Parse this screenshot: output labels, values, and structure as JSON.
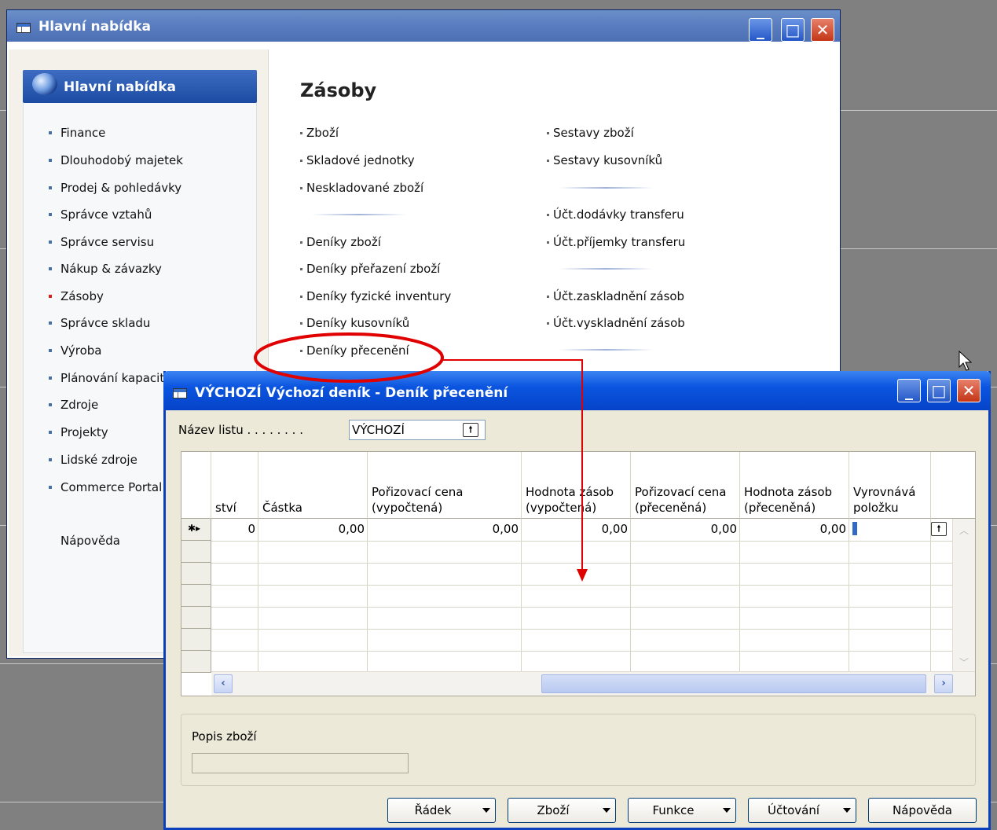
{
  "main_window": {
    "title": "Hlavní nabídka",
    "panel_header": "Hlavní nabídka",
    "nav_items": [
      {
        "label": "Finance"
      },
      {
        "label": "Dlouhodobý majetek"
      },
      {
        "label": "Prodej & pohledávky"
      },
      {
        "label": "Správce vztahů"
      },
      {
        "label": "Správce servisu"
      },
      {
        "label": "Nákup & závazky"
      },
      {
        "label": "Zásoby",
        "active": true
      },
      {
        "label": "Správce skladu"
      },
      {
        "label": "Výroba"
      },
      {
        "label": "Plánování kapacit"
      },
      {
        "label": "Zdroje"
      },
      {
        "label": "Projekty"
      },
      {
        "label": "Lidské zdroje"
      },
      {
        "label": "Commerce Portal"
      }
    ],
    "help_label": "Nápověda",
    "section_title": "Zásoby",
    "links_left": [
      "Zboží",
      "Skladové jednotky",
      "Neskladované zboží",
      "Deníky zboží",
      "Deníky přeřazení zboží",
      "Deníky fyzické inventury",
      "Deníky kusovníků",
      "Deníky přecenění"
    ],
    "links_right": [
      "Sestavy zboží",
      "Sestavy kusovníků",
      "Účt.dodávky transferu",
      "Účt.příjemky transferu",
      "Účt.zaskladnění zásob",
      "Účt.vyskladnění zásob"
    ]
  },
  "journal_window": {
    "title": "VÝCHOZÍ Výchozí deník - Deník přecenění",
    "batch_label": "Název listu . . . . . . . .",
    "batch_value": "VÝCHOZÍ",
    "columns": [
      "ství",
      "Částka",
      "Pořizovací cena\n(vypočtená)",
      "Hodnota zásob\n(vypočtená)",
      "Pořizovací cena\n(přeceněná)",
      "Hodnota zásob\n(přeceněná)",
      "Vyrovnává\npoložku"
    ],
    "row_values": [
      "0",
      "0,00",
      "0,00",
      "0,00",
      "0,00",
      "0,00"
    ],
    "row_marker": "✱▸",
    "item_desc_label": "Popis zboží",
    "buttons": [
      "Řádek",
      "Zboží",
      "Funkce",
      "Účtování",
      "Nápověda"
    ]
  },
  "colors": {
    "annotation": "#e00000",
    "title_blue": "#0b55e0"
  }
}
